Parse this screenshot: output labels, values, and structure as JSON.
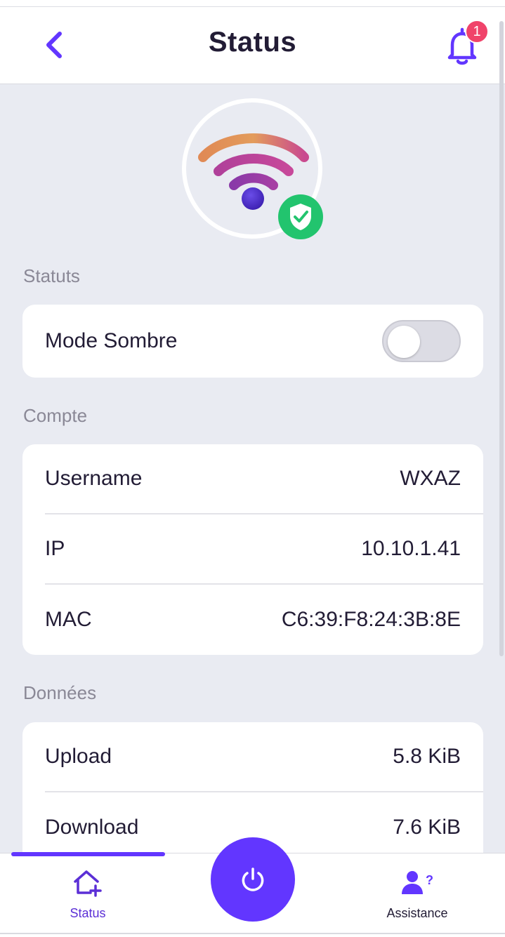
{
  "header": {
    "title": "Status",
    "notification_count": "1"
  },
  "sections": {
    "statuts": {
      "label": "Statuts",
      "dark_mode": {
        "label": "Mode Sombre",
        "enabled": false
      }
    },
    "compte": {
      "label": "Compte",
      "rows": [
        {
          "label": "Username",
          "value": "WXAZ"
        },
        {
          "label": "IP",
          "value": "10.10.1.41"
        },
        {
          "label": "MAC",
          "value": "C6:39:F8:24:3B:8E"
        }
      ]
    },
    "donnees": {
      "label": "Données",
      "rows": [
        {
          "label": "Upload",
          "value": "5.8 KiB"
        },
        {
          "label": "Download",
          "value": "7.6 KiB"
        }
      ]
    }
  },
  "bottom_nav": {
    "status_label": "Status",
    "assistance_label": "Assistance"
  },
  "colors": {
    "accent": "#6236ff",
    "badge": "#f0436a",
    "shield": "#22c46e",
    "background": "#e9ebf2"
  },
  "icons": {
    "back": "chevron-left-icon",
    "bell": "bell-icon",
    "wifi": "wifi-icon",
    "shield": "shield-check-icon",
    "home": "home-add-icon",
    "power": "power-icon",
    "assistance": "user-question-icon"
  }
}
